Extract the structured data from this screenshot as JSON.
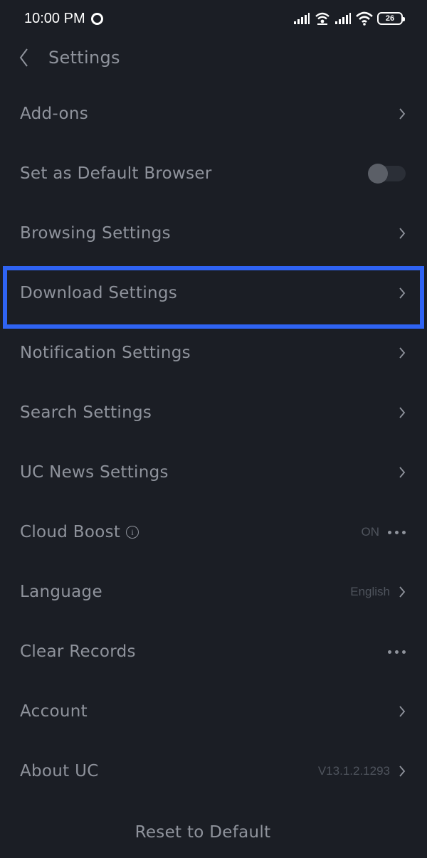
{
  "status_bar": {
    "time": "10:00 PM",
    "battery": "26"
  },
  "header": {
    "back_icon": "chevron-left-icon",
    "title": "Settings"
  },
  "settings": [
    {
      "label": "Add-ons",
      "control": "chevron"
    },
    {
      "label": "Set as Default Browser",
      "control": "toggle",
      "toggle_on": false
    },
    {
      "label": "Browsing Settings",
      "control": "chevron"
    },
    {
      "label": "Download Settings",
      "control": "chevron",
      "highlighted": true
    },
    {
      "label": "Notification Settings",
      "control": "chevron"
    },
    {
      "label": "Search Settings",
      "control": "chevron"
    },
    {
      "label": "UC News Settings",
      "control": "chevron"
    },
    {
      "label": "Cloud Boost",
      "control": "more",
      "value": "ON",
      "info_icon": "info-icon"
    },
    {
      "label": "Language",
      "control": "chevron",
      "value": "English"
    },
    {
      "label": "Clear Records",
      "control": "more"
    },
    {
      "label": "Account",
      "control": "chevron"
    },
    {
      "label": "About UC",
      "control": "chevron",
      "value": "V13.1.2.1293"
    }
  ],
  "footer": {
    "reset_label": "Reset to Default"
  },
  "colors": {
    "background": "#1b1e25",
    "text": "#8f939c",
    "value_text": "#4f545d",
    "highlight": "#2f63f3"
  }
}
